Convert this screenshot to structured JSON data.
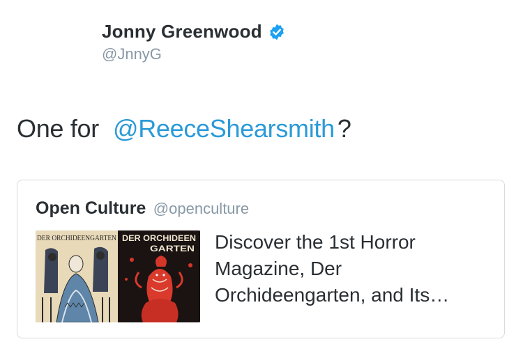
{
  "tweet": {
    "author": {
      "name": "Jonny Greenwood",
      "handle": "@JnnyG",
      "verified": true
    },
    "text_before": "One for",
    "mention": "@ReeceShearsmith",
    "text_after": "?"
  },
  "quoted": {
    "name": "Open Culture",
    "handle": "@openculture",
    "thumbnail": {
      "icon": "magazine-cover-image",
      "left_title": "DER ORCHIDEENGARTEN",
      "right_title_line1": "DER ORCHIDEEN",
      "right_title_line2": "GARTEN"
    },
    "description_lines": [
      "Discover the 1st Horror",
      "Magazine, Der",
      "Orchideengarten, and Its…"
    ]
  },
  "colors": {
    "text": "#292f33",
    "muted": "#8899a6",
    "link": "#2b9ad8",
    "verified": "#1da1f2",
    "border": "#d6dbe0"
  }
}
